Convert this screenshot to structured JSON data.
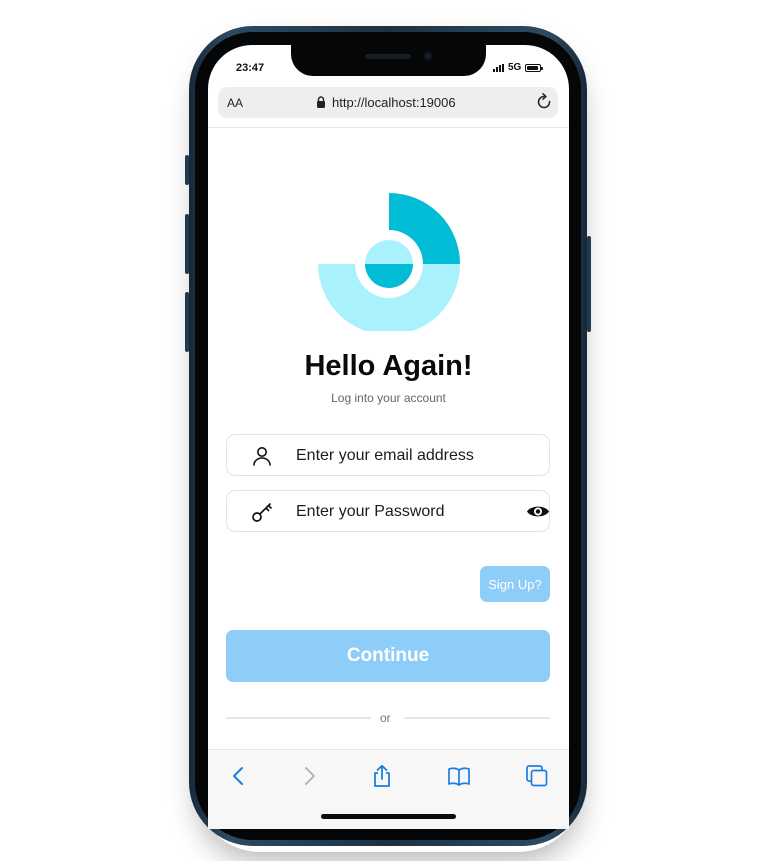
{
  "status_bar": {
    "time": "23:47",
    "network": "5G"
  },
  "browser": {
    "text_size_label": "AA",
    "url": "http://localhost:19006"
  },
  "login": {
    "title": "Hello Again!",
    "subtitle": "Log into your account",
    "email_placeholder": "Enter your email address",
    "password_placeholder": "Enter your Password",
    "signup_label": "Sign Up?",
    "continue_label": "Continue",
    "divider_label": "or"
  },
  "colors": {
    "accent": "#8dcdf8",
    "logo_dark": "#00bcd4",
    "logo_light": "#a9f2fd"
  },
  "icons": {
    "email_field": "user-icon",
    "password_field": "key-icon",
    "password_toggle": "eye-icon",
    "toolbar": [
      "back-icon",
      "forward-icon",
      "share-icon",
      "bookmarks-icon",
      "tabs-icon"
    ]
  }
}
